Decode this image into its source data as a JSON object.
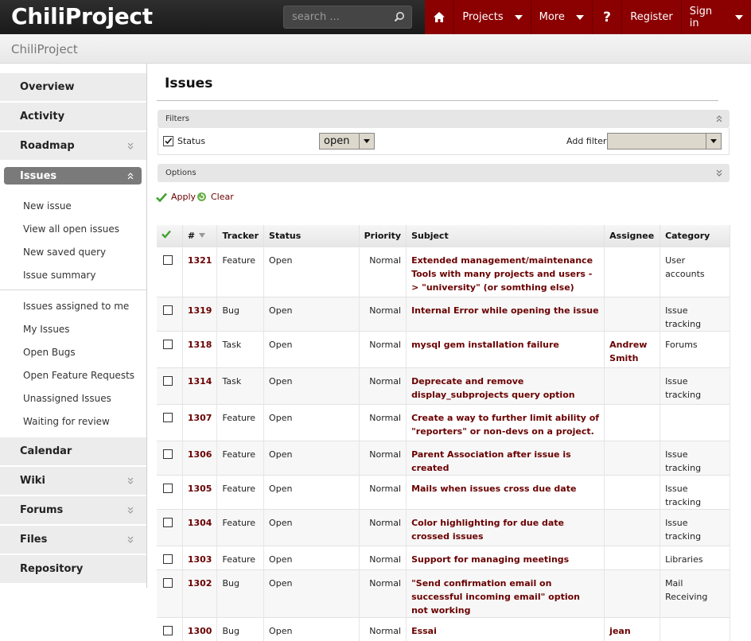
{
  "app": {
    "logo": "ChiliProject",
    "search_placeholder": "search ...",
    "nav": {
      "projects": "Projects",
      "more": "More",
      "help": "?",
      "register": "Register",
      "signin": "Sign in"
    }
  },
  "project": {
    "name": "ChiliProject"
  },
  "sidebar": {
    "overview": "Overview",
    "activity": "Activity",
    "roadmap": "Roadmap",
    "issues": "Issues",
    "issue_links": [
      "New issue",
      "View all open issues",
      "New saved query",
      "Issue summary"
    ],
    "queries": [
      "Issues assigned to me",
      "My Issues",
      "Open Bugs",
      "Open Feature Requests",
      "Unassigned Issues",
      "Waiting for review"
    ],
    "calendar": "Calendar",
    "wiki": "Wiki",
    "forums": "Forums",
    "files": "Files",
    "repository": "Repository"
  },
  "main": {
    "title": "Issues",
    "filters_legend": "Filters",
    "status_label": "Status",
    "status_value": "open",
    "add_filter_label": "Add filter:",
    "options_legend": "Options",
    "apply": "Apply",
    "clear": "Clear",
    "columns": [
      "#",
      "Tracker",
      "Status",
      "Priority",
      "Subject",
      "Assignee",
      "Category"
    ],
    "issues": [
      {
        "id": "1321",
        "tracker": "Feature",
        "status": "Open",
        "priority": "Normal",
        "subject": "Extended management/maintenance Tools with many projects and users -> \"university\" (or somthing else)",
        "assignee": "",
        "category": "User accounts"
      },
      {
        "id": "1319",
        "tracker": "Bug",
        "status": "Open",
        "priority": "Normal",
        "subject": "Internal Error while opening the issue",
        "assignee": "",
        "category": "Issue tracking"
      },
      {
        "id": "1318",
        "tracker": "Task",
        "status": "Open",
        "priority": "Normal",
        "subject": "mysql gem installation failure",
        "assignee": "Andrew Smith",
        "category": "Forums"
      },
      {
        "id": "1314",
        "tracker": "Task",
        "status": "Open",
        "priority": "Normal",
        "subject": "Deprecate and remove display_subprojects query option",
        "assignee": "",
        "category": "Issue tracking"
      },
      {
        "id": "1307",
        "tracker": "Feature",
        "status": "Open",
        "priority": "Normal",
        "subject": "Create a way to further limit ability of \"reporters\" or non-devs on a project.",
        "assignee": "",
        "category": ""
      },
      {
        "id": "1306",
        "tracker": "Feature",
        "status": "Open",
        "priority": "Normal",
        "subject": "Parent Association after issue is created",
        "assignee": "",
        "category": "Issue tracking"
      },
      {
        "id": "1305",
        "tracker": "Feature",
        "status": "Open",
        "priority": "Normal",
        "subject": "Mails when issues cross due date",
        "assignee": "",
        "category": "Issue tracking"
      },
      {
        "id": "1304",
        "tracker": "Feature",
        "status": "Open",
        "priority": "Normal",
        "subject": "Color highlighting for due date crossed issues",
        "assignee": "",
        "category": "Issue tracking"
      },
      {
        "id": "1303",
        "tracker": "Feature",
        "status": "Open",
        "priority": "Normal",
        "subject": "Support for managing meetings",
        "assignee": "",
        "category": "Libraries"
      },
      {
        "id": "1302",
        "tracker": "Bug",
        "status": "Open",
        "priority": "Normal",
        "subject": "\"Send confirmation email on successful incoming email\" option not working",
        "assignee": "",
        "category": "Mail Receiving"
      },
      {
        "id": "1300",
        "tracker": "Bug",
        "status": "Open",
        "priority": "Normal",
        "subject": "Essai",
        "assignee": "jean",
        "category": ""
      }
    ]
  }
}
